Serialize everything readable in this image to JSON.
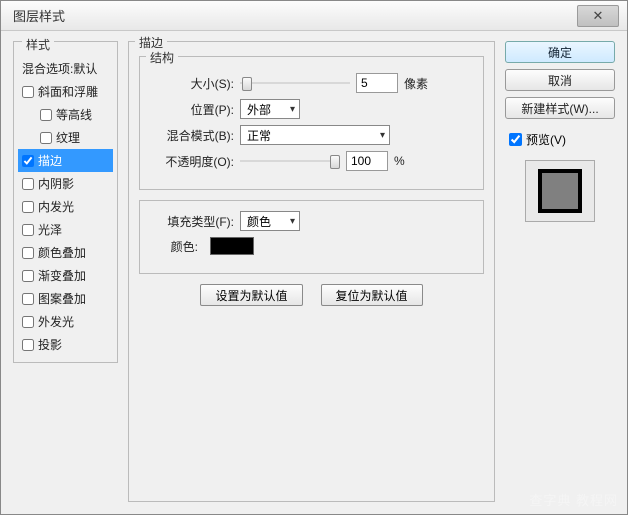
{
  "window": {
    "title": "图层样式"
  },
  "left": {
    "header": "样式",
    "blending": "混合选项:默认",
    "items": [
      {
        "label": "斜面和浮雕",
        "checked": false,
        "indent": false
      },
      {
        "label": "等高线",
        "checked": false,
        "indent": true
      },
      {
        "label": "纹理",
        "checked": false,
        "indent": true
      },
      {
        "label": "描边",
        "checked": true,
        "indent": false,
        "selected": true
      },
      {
        "label": "内阴影",
        "checked": false,
        "indent": false
      },
      {
        "label": "内发光",
        "checked": false,
        "indent": false
      },
      {
        "label": "光泽",
        "checked": false,
        "indent": false
      },
      {
        "label": "颜色叠加",
        "checked": false,
        "indent": false
      },
      {
        "label": "渐变叠加",
        "checked": false,
        "indent": false
      },
      {
        "label": "图案叠加",
        "checked": false,
        "indent": false
      },
      {
        "label": "外发光",
        "checked": false,
        "indent": false
      },
      {
        "label": "投影",
        "checked": false,
        "indent": false
      }
    ]
  },
  "center": {
    "title": "描边",
    "structure": {
      "title": "结构",
      "size_label": "大小(S):",
      "size_value": "5",
      "size_unit": "像素",
      "position_label": "位置(P):",
      "position_value": "外部",
      "blend_label": "混合模式(B):",
      "blend_value": "正常",
      "opacity_label": "不透明度(O):",
      "opacity_value": "100",
      "opacity_unit": "%"
    },
    "fill": {
      "type_label": "填充类型(F):",
      "type_value": "颜色",
      "color_label": "颜色:",
      "color_value": "#000000"
    },
    "buttons": {
      "set_default": "设置为默认值",
      "reset_default": "复位为默认值"
    }
  },
  "right": {
    "ok": "确定",
    "cancel": "取消",
    "new_style": "新建样式(W)...",
    "preview_label": "预览(V)",
    "preview_checked": true
  },
  "watermark": "查字典 教程网"
}
